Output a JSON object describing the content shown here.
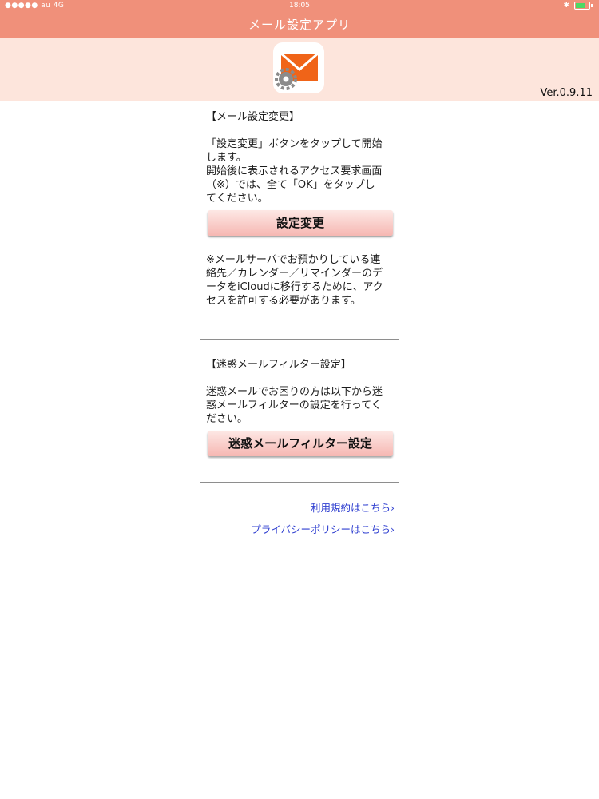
{
  "status_bar": {
    "carrier": "●●●●● au   4G",
    "time": "18:05"
  },
  "app": {
    "title": "メール設定アプリ",
    "version": "Ver.0.9.11"
  },
  "mail_settings": {
    "heading": "【メール設定変更】",
    "instructions": "「設定変更」ボタンをタップして開始\nします。\n開始後に表示されるアクセス要求画面\n（※）では、全て「OK」をタップし\nてください。",
    "button_label": "設定変更",
    "note": "※メールサーバでお預かりしている連\n絡先／カレンダー／リマインダーのデ\nータをiCloudに移行するために、アク\nセスを許可する必要があります。"
  },
  "spam_filter": {
    "heading": "【迷惑メールフィルター設定】",
    "description": "迷惑メールでお困りの方は以下から迷\n惑メールフィルターの設定を行ってく\nださい。",
    "button_label": "迷惑メールフィルター設定"
  },
  "links": {
    "terms": "利用規約はこちら›",
    "privacy": "プライバシーポリシーはこちら›"
  },
  "colors": {
    "topbar": "#f0907a",
    "header_band": "#fde5dc",
    "mail_icon": "#f06418",
    "link": "#2f3fd0"
  },
  "icons": [
    "envelope-icon",
    "gear-icon",
    "battery-icon",
    "bluetooth-icon"
  ]
}
